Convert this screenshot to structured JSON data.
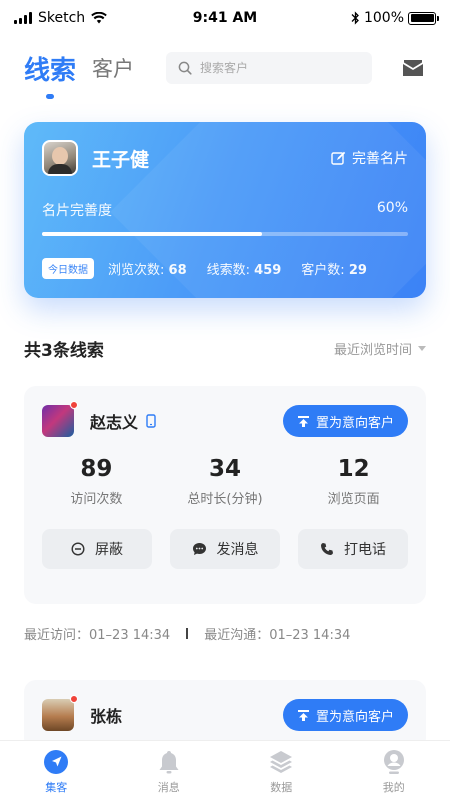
{
  "status_bar": {
    "carrier": "Sketch",
    "time": "9:41 AM",
    "battery": "100%"
  },
  "header": {
    "tab_active": "线索",
    "tab_inactive": "客户",
    "search_placeholder": "搜索客户"
  },
  "profile": {
    "name": "王子健",
    "complete_link": "完善名片",
    "progress_label": "名片完善度",
    "progress_value": "60%",
    "progress_fraction": 0.6,
    "today_badge": "今日数据",
    "views_label": "浏览次数:",
    "views_value": "68",
    "leads_label": "线索数:",
    "leads_value": "459",
    "customers_label": "客户数:",
    "customers_value": "29"
  },
  "leads_section": {
    "title": "共3条线索",
    "sort_label": "最近浏览时间"
  },
  "leads": [
    {
      "name": "赵志义",
      "intent_button": "置为意向客户",
      "metrics": [
        {
          "value": "89",
          "label": "访问次数"
        },
        {
          "value": "34",
          "label": "总时长(分钟)"
        },
        {
          "value": "12",
          "label": "浏览页面"
        }
      ],
      "actions": [
        "屏蔽",
        "发消息",
        "打电话"
      ],
      "last_visit": "最近访问：01–23 14:34",
      "last_contact": "最近沟通：01–23 14:34"
    },
    {
      "name": "张栋",
      "intent_button": "置为意向客户"
    }
  ],
  "bottom_nav": [
    {
      "label": "集客",
      "icon": "compass-icon",
      "active": true
    },
    {
      "label": "消息",
      "icon": "bell-icon",
      "active": false
    },
    {
      "label": "数据",
      "icon": "layers-icon",
      "active": false
    },
    {
      "label": "我的",
      "icon": "profile-icon",
      "active": false
    }
  ],
  "colors": {
    "accent": "#2f7cf6",
    "badge_red": "#f0433a"
  }
}
